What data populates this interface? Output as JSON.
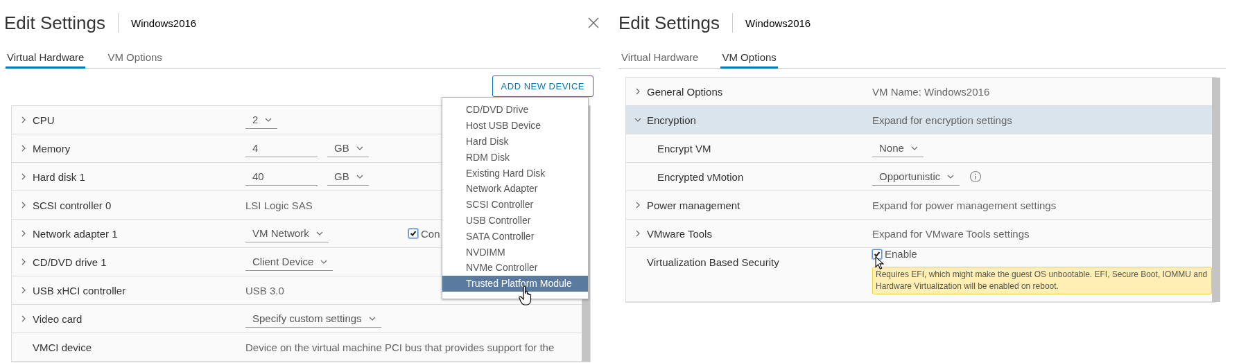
{
  "panels": [
    {
      "title": "Edit Settings",
      "subtitle": "Windows2016",
      "closable": true,
      "tabs": [
        {
          "label": "Virtual Hardware",
          "selected": true
        },
        {
          "label": "VM Options",
          "selected": false
        }
      ],
      "action": "ADD NEW DEVICE",
      "rows": [
        {
          "kind": "group",
          "expanded": false,
          "selected": false,
          "label": "CPU",
          "controls": [
            {
              "kind": "select",
              "value": "2"
            }
          ]
        },
        {
          "kind": "group",
          "expanded": false,
          "selected": false,
          "label": "Memory",
          "controls": [
            {
              "kind": "input",
              "value": "4"
            },
            {
              "kind": "select",
              "value": "GB"
            }
          ]
        },
        {
          "kind": "group",
          "expanded": false,
          "selected": false,
          "label": "Hard disk 1",
          "controls": [
            {
              "kind": "input",
              "value": "40"
            },
            {
              "kind": "select",
              "value": "GB"
            }
          ]
        },
        {
          "kind": "group",
          "expanded": false,
          "selected": false,
          "label": "SCSI controller 0",
          "controls": [
            {
              "kind": "text",
              "value": "LSI Logic SAS"
            }
          ]
        },
        {
          "kind": "group",
          "expanded": false,
          "selected": false,
          "label": "Network adapter 1",
          "controls": [
            {
              "kind": "select",
              "value": "VM Network"
            }
          ],
          "extra": {
            "kind": "checkbox",
            "checked": true,
            "label": "Con"
          }
        },
        {
          "kind": "group",
          "expanded": false,
          "selected": false,
          "label": "CD/DVD drive 1",
          "controls": [
            {
              "kind": "select",
              "value": "Client Device"
            }
          ]
        },
        {
          "kind": "group",
          "expanded": false,
          "selected": false,
          "label": "USB xHCI controller",
          "controls": [
            {
              "kind": "text",
              "value": "USB 3.0"
            }
          ]
        },
        {
          "kind": "group",
          "expanded": false,
          "selected": false,
          "label": "Video card",
          "controls": [
            {
              "kind": "select",
              "value": "Specify custom settings"
            }
          ]
        },
        {
          "kind": "plain",
          "selected": false,
          "label": "VMCI device",
          "controls": [
            {
              "kind": "text",
              "value": "Device on the virtual machine PCI bus that provides support for the"
            }
          ]
        }
      ],
      "menu": {
        "items": [
          {
            "label": "CD/DVD Drive",
            "selected": false
          },
          {
            "label": "Host USB Device",
            "selected": false
          },
          {
            "label": "Hard Disk",
            "selected": false
          },
          {
            "label": "RDM Disk",
            "selected": false
          },
          {
            "label": "Existing Hard Disk",
            "selected": false
          },
          {
            "label": "Network Adapter",
            "selected": false
          },
          {
            "label": "SCSI Controller",
            "selected": false
          },
          {
            "label": "USB Controller",
            "selected": false
          },
          {
            "label": "SATA Controller",
            "selected": false
          },
          {
            "label": "NVDIMM",
            "selected": false
          },
          {
            "label": "NVMe Controller",
            "selected": false
          },
          {
            "label": "Trusted Platform Module",
            "selected": true
          }
        ]
      }
    },
    {
      "title": "Edit Settings",
      "subtitle": "Windows2016",
      "closable": false,
      "tabs": [
        {
          "label": "Virtual Hardware",
          "selected": false
        },
        {
          "label": "VM Options",
          "selected": true
        }
      ],
      "rows": [
        {
          "kind": "group",
          "expanded": false,
          "selected": false,
          "label": "General Options",
          "controls": [
            {
              "kind": "text",
              "value": "VM Name: Windows2016"
            }
          ]
        },
        {
          "kind": "group",
          "expanded": true,
          "selected": true,
          "label": "Encryption",
          "controls": [
            {
              "kind": "text",
              "value": "Expand for encryption settings"
            }
          ]
        },
        {
          "kind": "sub",
          "selected": false,
          "label": "Encrypt VM",
          "controls": [
            {
              "kind": "select",
              "value": "None"
            }
          ]
        },
        {
          "kind": "sub",
          "selected": false,
          "label": "Encrypted vMotion",
          "controls": [
            {
              "kind": "select",
              "value": "Opportunistic"
            },
            {
              "kind": "info"
            }
          ]
        },
        {
          "kind": "group",
          "expanded": false,
          "selected": false,
          "label": "Power management",
          "controls": [
            {
              "kind": "text",
              "value": "Expand for power management settings"
            }
          ]
        },
        {
          "kind": "group",
          "expanded": false,
          "selected": false,
          "label": "VMware Tools",
          "controls": [
            {
              "kind": "text",
              "value": "Expand for VMware Tools settings"
            }
          ]
        },
        {
          "kind": "plain",
          "selected": false,
          "label": "Virtualization Based Security",
          "controls": [
            {
              "kind": "checkbox",
              "checked": true,
              "label": "Enable"
            },
            {
              "kind": "note",
              "value": "Requires EFI, which might make the guest OS unbootable. EFI, Secure Boot, IOMMU and Hardware Virtualization will be enabled on reboot."
            }
          ]
        }
      ]
    }
  ]
}
